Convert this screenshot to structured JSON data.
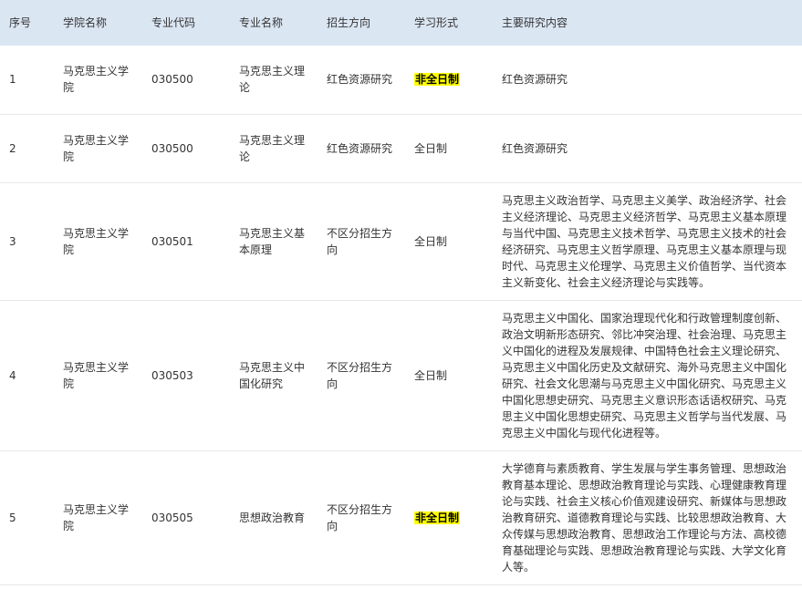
{
  "headers": {
    "seq": "序号",
    "college": "学院名称",
    "major_code": "专业代码",
    "major_name": "专业名称",
    "direction": "招生方向",
    "study_mode": "学习形式",
    "research": "主要研究内容"
  },
  "rows": [
    {
      "seq": "1",
      "college": "马克思主义学院",
      "major_code": "030500",
      "major_name": "马克思主义理论",
      "direction": "红色资源研究",
      "study_mode": "非全日制",
      "study_mode_highlighted": true,
      "research": "红色资源研究"
    },
    {
      "seq": "2",
      "college": "马克思主义学院",
      "major_code": "030500",
      "major_name": "马克思主义理论",
      "direction": "红色资源研究",
      "study_mode": "全日制",
      "study_mode_highlighted": false,
      "research": "红色资源研究"
    },
    {
      "seq": "3",
      "college": "马克思主义学院",
      "major_code": "030501",
      "major_name": "马克思主义基本原理",
      "direction": "不区分招生方向",
      "study_mode": "全日制",
      "study_mode_highlighted": false,
      "research": "马克思主义政治哲学、马克思主义美学、政治经济学、社会主义经济理论、马克思主义经济哲学、马克思主义基本原理与当代中国、马克思主义技术哲学、马克思主义技术的社会经济研究、马克思主义哲学原理、马克思主义基本原理与现时代、马克思主义伦理学、马克思主义价值哲学、当代资本主义新变化、社会主义经济理论与实践等。"
    },
    {
      "seq": "4",
      "college": "马克思主义学院",
      "major_code": "030503",
      "major_name": "马克思主义中国化研究",
      "direction": "不区分招生方向",
      "study_mode": "全日制",
      "study_mode_highlighted": false,
      "research": "马克思主义中国化、国家治理现代化和行政管理制度创新、政治文明新形态研究、邻比冲突治理、社会治理、马克思主义中国化的进程及发展规律、中国特色社会主义理论研究、马克思主义中国化历史及文献研究、海外马克思主义中国化研究、社会文化思潮与马克思主义中国化研究、马克思主义中国化思想史研究、马克思主义意识形态话语权研究、马克思主义中国化思想史研究、马克思主义哲学与当代发展、马克思主义中国化与现代化进程等。"
    },
    {
      "seq": "5",
      "college": "马克思主义学院",
      "major_code": "030505",
      "major_name": "思想政治教育",
      "direction": "不区分招生方向",
      "study_mode": "非全日制",
      "study_mode_highlighted": true,
      "research": "大学德育与素质教育、学生发展与学生事务管理、思想政治教育基本理论、思想政治教育理论与实践、心理健康教育理论与实践、社会主义核心价值观建设研究、新媒体与思想政治教育研究、道德教育理论与实践、比较思想政治教育、大众传媒与思想政治教育、思想政治工作理论与方法、高校德育基础理论与实践、思想政治教育理论与实践、大学文化育人等。"
    }
  ],
  "colors": {
    "header_bg": "#dbe6f3",
    "highlight": "#ffff00",
    "row_border": "#e8e8e8"
  }
}
